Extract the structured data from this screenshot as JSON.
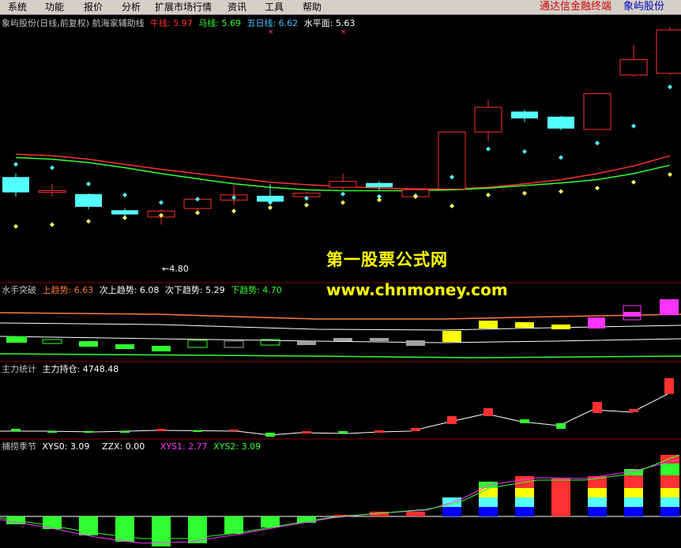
{
  "menu": {
    "items": [
      "系统",
      "功能",
      "报价",
      "分析",
      "扩展市场行情",
      "资讯",
      "工具",
      "帮助"
    ],
    "brand_link_1": "通达信金融终端",
    "brand_link_2": "象屿股份"
  },
  "main_panel": {
    "title": "象屿股份(日线,前复权) 航海家辅助线",
    "indicators": [
      {
        "label": "牛线: 5.97",
        "color": "#ff3030"
      },
      {
        "label": "马线: 5.69",
        "color": "#30ff30"
      },
      {
        "label": "五日线: 6.62",
        "color": "#40c0ff"
      },
      {
        "label": "水平面: 5.63",
        "color": "#ffffff"
      }
    ],
    "low_label": "←4.80",
    "markers": [
      "×",
      "×"
    ]
  },
  "panel2": {
    "title": "水手突破",
    "indicators": [
      {
        "label": "上趋势: 6.63",
        "color": "#ff7a3a"
      },
      {
        "label": "次上趋势: 6.08",
        "color": "#ffffff"
      },
      {
        "label": "次下趋势: 5.29",
        "color": "#ffffff"
      },
      {
        "label": "下趋势: 4.70",
        "color": "#30ff30"
      }
    ]
  },
  "panel3": {
    "title": "主力统计",
    "indicators": [
      {
        "label": "主力持仓: 4748.48",
        "color": "#ffffff"
      }
    ]
  },
  "panel4": {
    "title": "捕捞季节",
    "indicators": [
      {
        "label": "XYS0: 3.09",
        "color": "#ffffff"
      },
      {
        "label": "ZZX: 0.00",
        "color": "#ffffff"
      },
      {
        "label": "XYS1: 2.77",
        "color": "#ff33ff"
      },
      {
        "label": "XYS2: 3.09",
        "color": "#30ff30"
      }
    ]
  },
  "watermark": {
    "line1": "第一股票公式网",
    "line2": "www.chnmoney.com"
  },
  "colors": {
    "up": "#ff3030",
    "down": "#54ffff",
    "grid": "#8b0000",
    "cyan_dot": "#54ffff",
    "yellow_dot": "#ffff66"
  },
  "chart_data": {
    "type": "candlestick",
    "ylim": [
      4.8,
      7.4
    ],
    "candles": [
      {
        "o": 5.68,
        "c": 5.5,
        "h": 5.72,
        "l": 5.45,
        "up": false
      },
      {
        "o": 5.5,
        "c": 5.52,
        "h": 5.6,
        "l": 5.45,
        "up": true
      },
      {
        "o": 5.48,
        "c": 5.33,
        "h": 5.49,
        "l": 5.3,
        "up": false
      },
      {
        "o": 5.29,
        "c": 5.24,
        "h": 5.31,
        "l": 5.19,
        "up": false
      },
      {
        "o": 5.21,
        "c": 5.28,
        "h": 5.3,
        "l": 5.12,
        "up": true
      },
      {
        "o": 5.31,
        "c": 5.42,
        "h": 5.45,
        "l": 5.24,
        "up": true
      },
      {
        "o": 5.41,
        "c": 5.47,
        "h": 5.58,
        "l": 5.35,
        "up": true
      },
      {
        "o": 5.46,
        "c": 5.39,
        "h": 5.6,
        "l": 5.37,
        "up": false
      },
      {
        "o": 5.45,
        "c": 5.49,
        "h": 5.51,
        "l": 5.4,
        "up": true
      },
      {
        "o": 5.56,
        "c": 5.63,
        "h": 5.72,
        "l": 5.52,
        "up": true
      },
      {
        "o": 5.61,
        "c": 5.56,
        "h": 5.63,
        "l": 5.52,
        "up": false
      },
      {
        "o": 5.45,
        "c": 5.53,
        "h": 5.55,
        "l": 5.42,
        "up": true
      },
      {
        "o": 5.54,
        "c": 6.21,
        "h": 6.21,
        "l": 5.54,
        "up": true
      },
      {
        "o": 6.21,
        "c": 6.5,
        "h": 6.59,
        "l": 6.1,
        "up": true
      },
      {
        "o": 6.45,
        "c": 6.37,
        "h": 6.47,
        "l": 6.33,
        "up": false
      },
      {
        "o": 6.39,
        "c": 6.25,
        "h": 6.4,
        "l": 6.23,
        "up": false
      },
      {
        "o": 6.24,
        "c": 6.66,
        "h": 6.66,
        "l": 6.24,
        "up": true
      },
      {
        "o": 6.88,
        "c": 7.06,
        "h": 7.23,
        "l": 6.86,
        "up": true
      },
      {
        "o": 6.9,
        "c": 7.41,
        "h": 7.44,
        "l": 6.88,
        "up": true
      }
    ],
    "cyan_dots": [
      5.83,
      5.79,
      5.6,
      5.47,
      5.38,
      5.42,
      5.44,
      5.38,
      5.43,
      5.48,
      5.45,
      5.46,
      5.68,
      6.01,
      5.98,
      5.91,
      6.08,
      6.28,
      6.74
    ],
    "yellow_dots": [
      5.1,
      5.12,
      5.16,
      5.2,
      5.23,
      5.26,
      5.28,
      5.32,
      5.35,
      5.38,
      5.41,
      5.45,
      5.34,
      5.47,
      5.49,
      5.51,
      5.55,
      5.62,
      5.71
    ],
    "ma_red": [
      5.95,
      5.93,
      5.89,
      5.83,
      5.77,
      5.72,
      5.67,
      5.62,
      5.59,
      5.57,
      5.55,
      5.54,
      5.54,
      5.56,
      5.6,
      5.65,
      5.72,
      5.81,
      5.93
    ],
    "ma_green": [
      5.91,
      5.89,
      5.85,
      5.79,
      5.72,
      5.66,
      5.6,
      5.56,
      5.53,
      5.52,
      5.52,
      5.52,
      5.53,
      5.55,
      5.58,
      5.61,
      5.65,
      5.72,
      5.82
    ]
  }
}
